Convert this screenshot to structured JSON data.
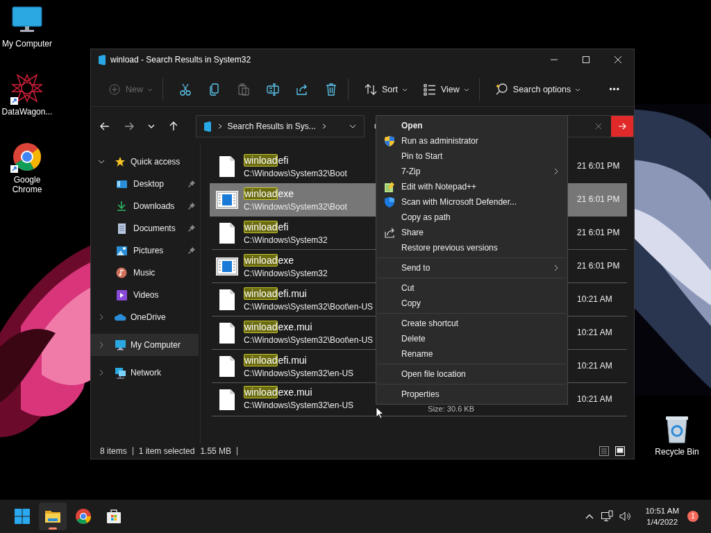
{
  "desktop": {
    "icons": [
      {
        "label": "My Computer",
        "kind": "monitor",
        "shortcut": false
      },
      {
        "label": "DataWagon...",
        "kind": "star",
        "shortcut": true
      },
      {
        "label": "Google\nChrome",
        "kind": "chrome",
        "shortcut": true
      },
      {
        "label": "Recycle Bin",
        "kind": "bin",
        "shortcut": false
      }
    ]
  },
  "window": {
    "title": "winload - Search Results in System32",
    "toolbar": [
      {
        "kind": "new",
        "label": "New",
        "disabled": true,
        "caret": true
      },
      {
        "kind": "cut",
        "disabled": false
      },
      {
        "kind": "copy",
        "disabled": false
      },
      {
        "kind": "paste",
        "disabled": true
      },
      {
        "kind": "rename",
        "disabled": false
      },
      {
        "kind": "share",
        "disabled": false
      },
      {
        "kind": "delete",
        "disabled": false
      },
      {
        "kind": "sort",
        "label": "Sort",
        "disabled": false,
        "caret": true
      },
      {
        "kind": "view",
        "label": "View",
        "disabled": false,
        "caret": true
      },
      {
        "kind": "search-options",
        "label": "Search options",
        "disabled": false,
        "caret": true
      },
      {
        "kind": "more",
        "label": "•••",
        "disabled": false
      }
    ],
    "address": {
      "crumb": "Search Results in Sys..."
    },
    "search": {
      "has_value": true
    },
    "sidebar": [
      {
        "label": "Quick access",
        "kind": "star",
        "expanded": true,
        "selected": false,
        "children": [
          {
            "label": "Desktop",
            "kind": "desktop",
            "pinned": true,
            "selected": false
          },
          {
            "label": "Downloads",
            "kind": "downloads",
            "pinned": true,
            "selected": false
          },
          {
            "label": "Documents",
            "kind": "documents",
            "pinned": true,
            "selected": false
          },
          {
            "label": "Pictures",
            "kind": "pictures",
            "pinned": true,
            "selected": false
          },
          {
            "label": "Music",
            "kind": "music",
            "pinned": false,
            "selected": false
          },
          {
            "label": "Videos",
            "kind": "videos",
            "pinned": false,
            "selected": false
          }
        ]
      },
      {
        "label": "OneDrive",
        "kind": "cloud",
        "expanded": false,
        "selected": false
      },
      {
        "label": "My Computer",
        "kind": "monitor",
        "expanded": false,
        "selected": true
      },
      {
        "label": "Network",
        "kind": "network",
        "expanded": false,
        "selected": false
      }
    ],
    "files": [
      {
        "match": "winload",
        "rest": "efi",
        "path": "C:\\Windows\\System32\\Boot",
        "modified": "21 6:01 PM",
        "kind": "file",
        "selected": false
      },
      {
        "match": "winload",
        "rest": "exe",
        "path": "C:\\Windows\\System32\\Boot",
        "modified": "21 6:01 PM",
        "kind": "app",
        "selected": true
      },
      {
        "match": "winload",
        "rest": "efi",
        "path": "C:\\Windows\\System32",
        "modified": "21 6:01 PM",
        "kind": "file",
        "selected": false
      },
      {
        "match": "winload",
        "rest": "exe",
        "path": "C:\\Windows\\System32",
        "modified": "21 6:01 PM",
        "kind": "app",
        "selected": false
      },
      {
        "match": "winload",
        "rest": "efi.mui",
        "path": "C:\\Windows\\System32\\Boot\\en-US",
        "modified": "10:21 AM",
        "kind": "file",
        "selected": false
      },
      {
        "match": "winload",
        "rest": "exe.mui",
        "path": "C:\\Windows\\System32\\Boot\\en-US",
        "modified": "10:21 AM",
        "kind": "file",
        "selected": false
      },
      {
        "match": "winload",
        "rest": "efi.mui",
        "path": "C:\\Windows\\System32\\en-US",
        "modified": "10:21 AM",
        "kind": "file",
        "selected": false
      },
      {
        "match": "winload",
        "rest": "exe.mui",
        "path": "C:\\Windows\\System32\\en-US",
        "modified": "10:21 AM",
        "size": "Size: 30.6 KB",
        "kind": "file",
        "selected": false
      }
    ],
    "status_bar": {
      "count": "8 items",
      "selection": "1 item selected",
      "size": "1.55 MB",
      "views": [
        {
          "kind": "details",
          "selected": false
        },
        {
          "kind": "tiles",
          "selected": true
        }
      ]
    }
  },
  "context_menu": [
    [
      {
        "label": "Open",
        "kind": "plain",
        "default": true,
        "submenu": false
      },
      {
        "label": "Run as administrator",
        "kind": "shield",
        "default": false,
        "submenu": false
      },
      {
        "label": "Pin to Start",
        "kind": "plain",
        "default": false,
        "submenu": false
      },
      {
        "label": "7-Zip",
        "kind": "plain",
        "default": false,
        "submenu": true
      },
      {
        "label": "Edit with Notepad++",
        "kind": "notepad",
        "default": false,
        "submenu": false
      },
      {
        "label": "Scan with Microsoft Defender...",
        "kind": "defender",
        "default": false,
        "submenu": false
      },
      {
        "label": "Copy as path",
        "kind": "plain",
        "default": false,
        "submenu": false
      },
      {
        "label": "Share",
        "kind": "share",
        "default": false,
        "submenu": false
      },
      {
        "label": "Restore previous versions",
        "kind": "plain",
        "default": false,
        "submenu": false
      }
    ],
    [
      {
        "label": "Send to",
        "kind": "plain",
        "default": false,
        "submenu": true
      }
    ],
    [
      {
        "label": "Cut",
        "kind": "plain",
        "default": false,
        "submenu": false
      },
      {
        "label": "Copy",
        "kind": "plain",
        "default": false,
        "submenu": false
      }
    ],
    [
      {
        "label": "Create shortcut",
        "kind": "plain",
        "default": false,
        "submenu": false
      },
      {
        "label": "Delete",
        "kind": "plain",
        "default": false,
        "submenu": false
      },
      {
        "label": "Rename",
        "kind": "plain",
        "default": false,
        "submenu": false
      }
    ],
    [
      {
        "label": "Open file location",
        "kind": "plain",
        "default": false,
        "submenu": false
      }
    ],
    [
      {
        "label": "Properties",
        "kind": "plain",
        "default": false,
        "submenu": false
      }
    ]
  ],
  "taskbar": {
    "apps": [
      {
        "kind": "start",
        "active": false
      },
      {
        "kind": "explorer",
        "active": true
      },
      {
        "kind": "chrome",
        "active": false
      },
      {
        "kind": "store",
        "active": false
      }
    ],
    "time": "10:51 AM",
    "date": "1/4/2022",
    "notifications": "1"
  }
}
